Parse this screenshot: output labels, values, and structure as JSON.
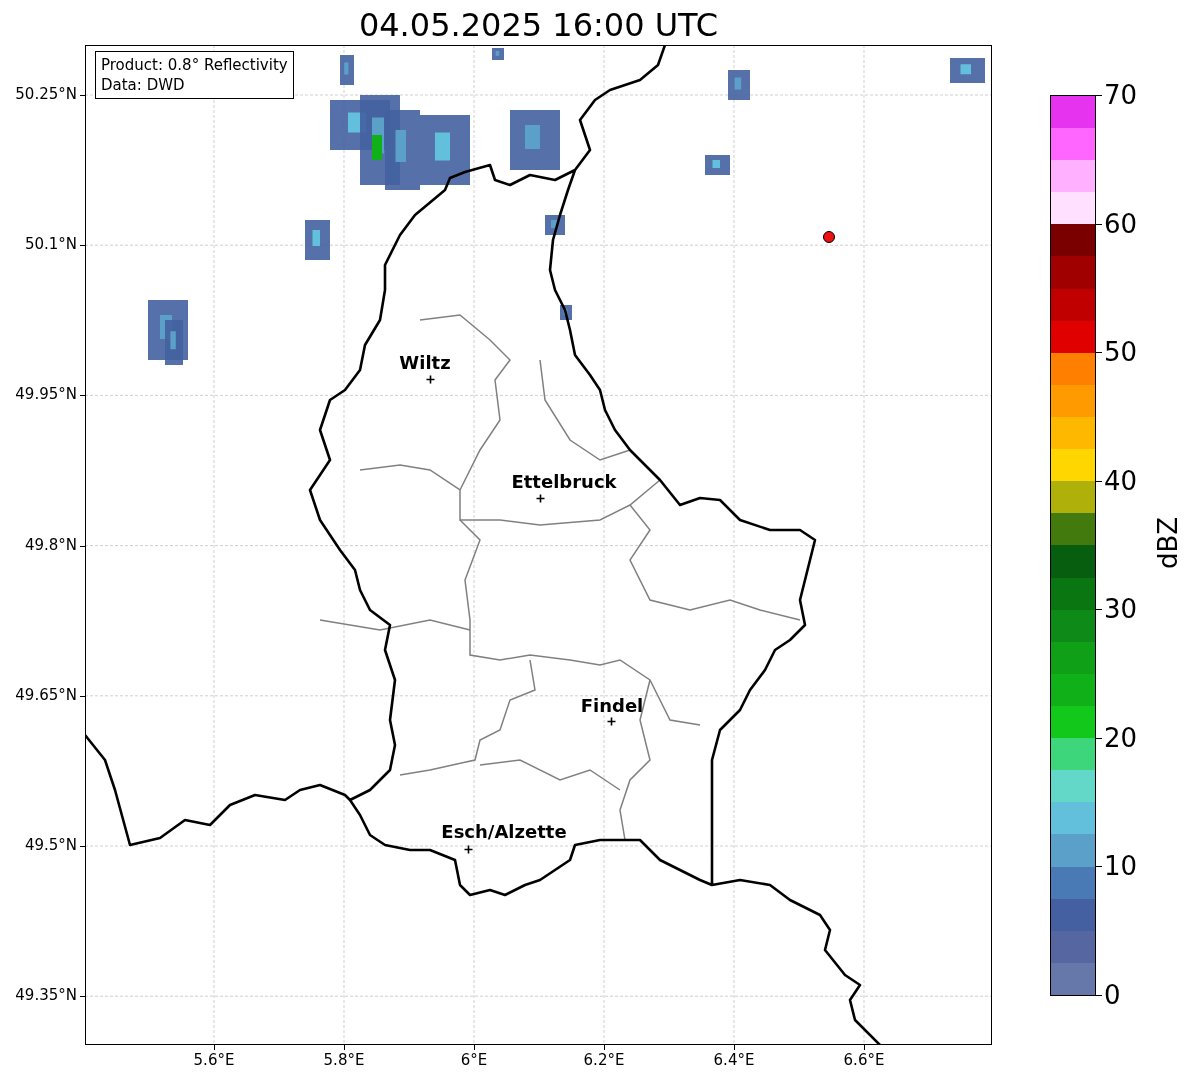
{
  "title": "04.05.2025 16:00 UTC",
  "info_box": [
    "Product: 0.8° Reflectivity",
    "Data: DWD"
  ],
  "map": {
    "y_ticks": [
      "50.25°N",
      "50.1°N",
      "49.95°N",
      "49.8°N",
      "49.65°N",
      "49.5°N",
      "49.35°N"
    ],
    "x_ticks": [
      "5.6°E",
      "5.8°E",
      "6°E",
      "6.2°E",
      "6.4°E",
      "6.6°E"
    ],
    "cities": [
      "Wiltz",
      "Ettelbruck",
      "Findel",
      "Esch/Alzette"
    ]
  },
  "colorbar": {
    "label": "dBZ",
    "ticks": [
      "70",
      "60",
      "50",
      "40",
      "30",
      "20",
      "10",
      "0"
    ],
    "bins": [
      {
        "color": "#6677aa"
      },
      {
        "color": "#5566a0"
      },
      {
        "color": "#4460a0"
      },
      {
        "color": "#4a7ab5"
      },
      {
        "color": "#5aa0c8"
      },
      {
        "color": "#63c0dc"
      },
      {
        "color": "#63d8c8"
      },
      {
        "color": "#3dd67a"
      },
      {
        "color": "#12c81a"
      },
      {
        "color": "#10b018"
      },
      {
        "color": "#10a018"
      },
      {
        "color": "#0e8a18"
      },
      {
        "color": "#0a7612"
      },
      {
        "color": "#065e0e"
      },
      {
        "color": "#437a0e"
      },
      {
        "color": "#b0b00a"
      },
      {
        "color": "#ffd600"
      },
      {
        "color": "#ffb800"
      },
      {
        "color": "#ff9a00"
      },
      {
        "color": "#ff7f00"
      },
      {
        "color": "#e00000"
      },
      {
        "color": "#c00000"
      },
      {
        "color": "#a00000"
      },
      {
        "color": "#7a0000"
      },
      {
        "color": "#ffe0ff"
      },
      {
        "color": "#ffb0ff"
      },
      {
        "color": "#ff66ff"
      },
      {
        "color": "#e633f0"
      }
    ]
  }
}
